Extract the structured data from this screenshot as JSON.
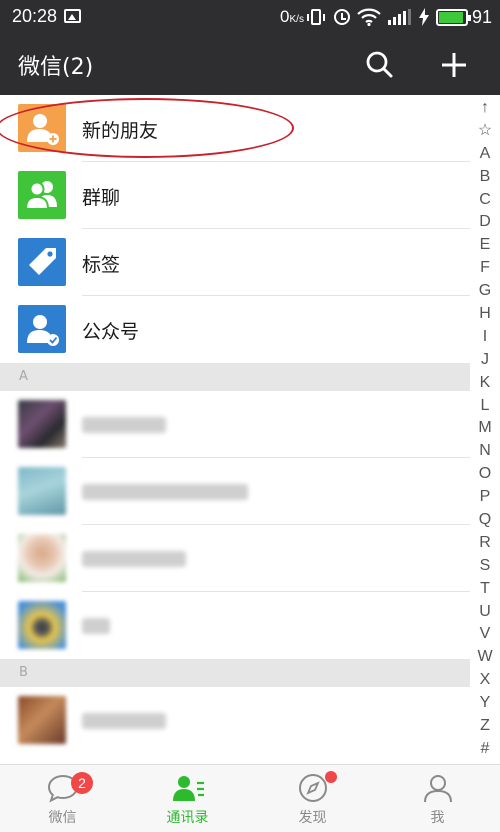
{
  "status_bar": {
    "time": "20:28",
    "net_speed": "0",
    "net_speed_unit": "K/s",
    "battery_level": "91",
    "battery_fraction": 0.91,
    "battery_color": "#3ec93a"
  },
  "header": {
    "title": "微信(2)",
    "icons": [
      "search-icon",
      "plus-icon"
    ]
  },
  "contacts": {
    "top_items": [
      {
        "label": "新的朋友",
        "icon": "new-friend-icon",
        "color": "#f5a04a"
      },
      {
        "label": "群聊",
        "icon": "group-chat-icon",
        "color": "#3fc43a"
      },
      {
        "label": "标签",
        "icon": "tag-icon",
        "color": "#2f7fd0"
      },
      {
        "label": "公众号",
        "icon": "official-account-icon",
        "color": "#2f7fd0"
      }
    ],
    "sections": [
      {
        "header": "A"
      },
      {
        "header": "B"
      }
    ]
  },
  "index_bar": [
    "↑",
    "☆",
    "A",
    "B",
    "C",
    "D",
    "E",
    "F",
    "G",
    "H",
    "I",
    "J",
    "K",
    "L",
    "M",
    "N",
    "O",
    "P",
    "Q",
    "R",
    "S",
    "T",
    "U",
    "V",
    "W",
    "X",
    "Y",
    "Z",
    "#"
  ],
  "tabs": [
    {
      "label": "微信",
      "icon": "chat-bubble-icon",
      "badge": "2",
      "active": false
    },
    {
      "label": "通讯录",
      "icon": "contacts-icon",
      "active": true
    },
    {
      "label": "发现",
      "icon": "compass-icon",
      "active": false
    },
    {
      "label": "我",
      "icon": "person-icon",
      "active": false
    }
  ],
  "colors": {
    "header_bg": "#2e2e30",
    "active_tab": "#2dbb2d",
    "badge": "#f04848",
    "annotation": "#c8222a"
  }
}
